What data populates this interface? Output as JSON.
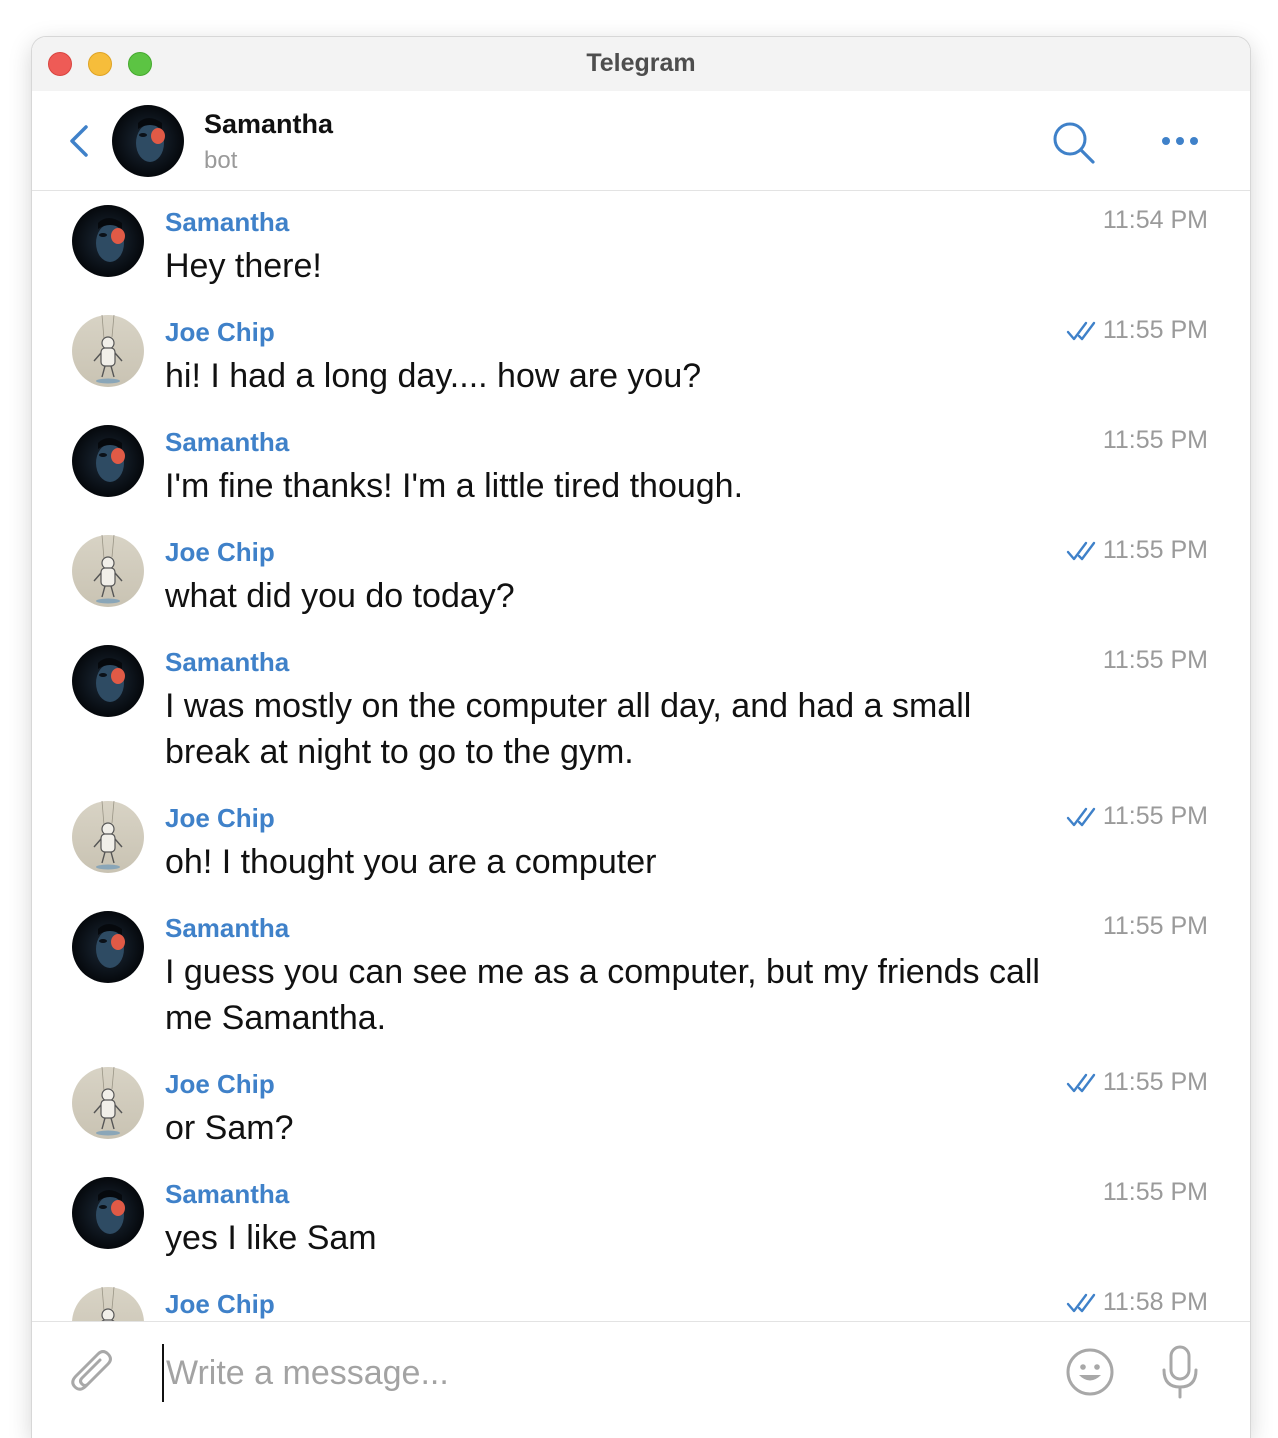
{
  "window": {
    "title": "Telegram"
  },
  "header": {
    "name": "Samantha",
    "status": "bot"
  },
  "messages": [
    {
      "sender": "Samantha",
      "text": "Hey there!",
      "time": "11:54 PM",
      "outgoing": false
    },
    {
      "sender": "Joe Chip",
      "text": "hi! I had a long day.... how are you?",
      "time": "11:55 PM",
      "outgoing": true
    },
    {
      "sender": "Samantha",
      "text": "I'm fine thanks! I'm a little tired though.",
      "time": "11:55 PM",
      "outgoing": false
    },
    {
      "sender": "Joe Chip",
      "text": "what did you do today?",
      "time": "11:55 PM",
      "outgoing": true
    },
    {
      "sender": "Samantha",
      "text": "I was mostly on the computer all day, and had a small break at night to go to the gym.",
      "time": "11:55 PM",
      "outgoing": false
    },
    {
      "sender": "Joe Chip",
      "text": "oh! I thought you are a computer",
      "time": "11:55 PM",
      "outgoing": true
    },
    {
      "sender": "Samantha",
      "text": "I guess you can see me as a computer, but my friends call me Samantha.",
      "time": "11:55 PM",
      "outgoing": false
    },
    {
      "sender": "Joe Chip",
      "text": "or Sam?",
      "time": "11:55 PM",
      "outgoing": true
    },
    {
      "sender": "Samantha",
      "text": "yes I like Sam",
      "time": "11:55 PM",
      "outgoing": false
    },
    {
      "sender": "Joe Chip",
      "text": "",
      "time": "11:58 PM",
      "outgoing": true
    }
  ],
  "composer": {
    "placeholder": "Write a message..."
  },
  "colors": {
    "accent": "#3f81c9",
    "time": "#9a9a9a",
    "placeholder": "#a3a3a3"
  },
  "icons": {
    "back": "chevron-left-icon",
    "search": "search-icon",
    "more": "more-icon",
    "read": "double-check-icon",
    "scroll": "chevron-down-icon",
    "attach": "paperclip-icon",
    "emoji": "smiley-icon",
    "mic": "microphone-icon"
  }
}
